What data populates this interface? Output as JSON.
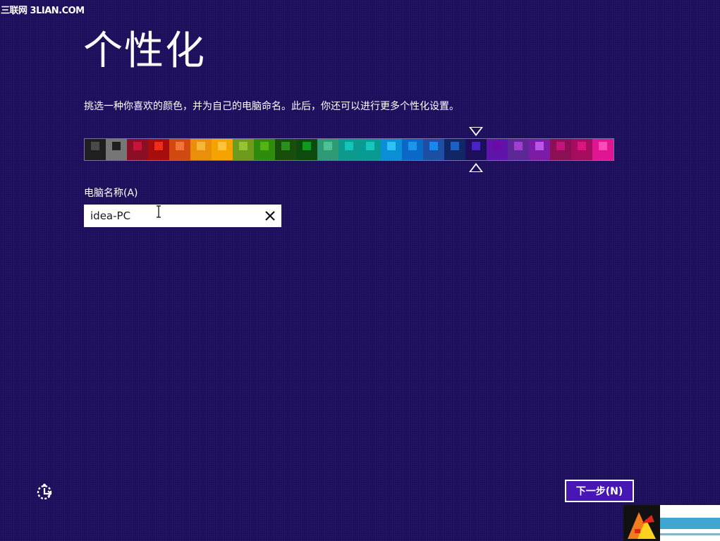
{
  "watermark": "三联网 3LIAN.COM",
  "page": {
    "title": "个性化",
    "instructions": "挑选一种你喜欢的颜色，并为自己的电脑命名。此后，你还可以进行更多个性化设置。"
  },
  "colors": {
    "selected_index": 18,
    "swatches": [
      {
        "bg": "#1f1f1f",
        "mark": "#4a4a4a"
      },
      {
        "bg": "#767676",
        "mark": "#1f1f1f"
      },
      {
        "bg": "#8a0e26",
        "mark": "#c8133b"
      },
      {
        "bg": "#a70d0d",
        "mark": "#ee2d1a"
      },
      {
        "bg": "#d24a10",
        "mark": "#f2743a"
      },
      {
        "bg": "#e98f0c",
        "mark": "#f7b63a"
      },
      {
        "bg": "#f4a300",
        "mark": "#fcc43a"
      },
      {
        "bg": "#6f9b1c",
        "mark": "#95c433"
      },
      {
        "bg": "#2f8b0c",
        "mark": "#56b314"
      },
      {
        "bg": "#184d0b",
        "mark": "#2a8f1d"
      },
      {
        "bg": "#0c4a0e",
        "mark": "#0d9a1d"
      },
      {
        "bg": "#2e9a76",
        "mark": "#4dc394"
      },
      {
        "bg": "#0d9a8e",
        "mark": "#15c4b8"
      },
      {
        "bg": "#089b93",
        "mark": "#15c7bd"
      },
      {
        "bg": "#0a8fd6",
        "mark": "#2dc1f4"
      },
      {
        "bg": "#0a68c7",
        "mark": "#1d94ee"
      },
      {
        "bg": "#1d4ea4",
        "mark": "#1a86f0"
      },
      {
        "bg": "#112765",
        "mark": "#1d5ec7"
      },
      {
        "bg": "#1d0e5c",
        "mark": "#4a22c9"
      },
      {
        "bg": "#5e14a8",
        "mark": "#6b0aa9"
      },
      {
        "bg": "#5e2797",
        "mark": "#9f3fcf"
      },
      {
        "bg": "#7b1ba6",
        "mark": "#bd53e8"
      },
      {
        "bg": "#8c0f56",
        "mark": "#c31578"
      },
      {
        "bg": "#a60c5e",
        "mark": "#dc1480"
      },
      {
        "bg": "#e01591",
        "mark": "#ff4ab7"
      }
    ]
  },
  "computer_name": {
    "label": "电脑名称(A)",
    "value": "idea-PC"
  },
  "footer": {
    "next_label": "下一步(N)"
  },
  "icons": {
    "clear": "close-icon",
    "ease_of_access": "ease-of-access-icon",
    "text_cursor": "text-cursor-icon"
  }
}
